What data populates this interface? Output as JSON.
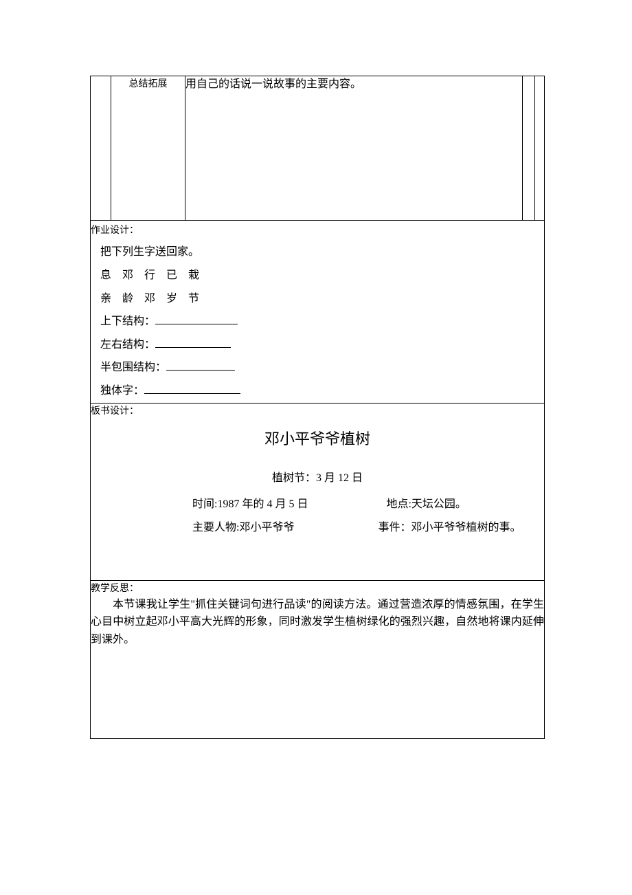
{
  "row1": {
    "label": "总结拓展",
    "content": "用自己的话说一说故事的主要内容。"
  },
  "homework": {
    "label": "作业设计：",
    "instruction": "把下列生字送回家。",
    "chars_line1": "息　邓　行　已　栽",
    "chars_line2": "亲　龄　邓　岁　节",
    "struct1_label": "上下结构：",
    "struct2_label": "左右结构：",
    "struct3_label": "半包围结构：",
    "struct4_label": "独体字："
  },
  "board": {
    "label": "板书设计：",
    "title": "邓小平爷爷植树",
    "subtitle": "植树节：3 月 12 日",
    "time_label": "时间:",
    "time_value": "1987 年的 4 月 5 日",
    "place_label": "地点:",
    "place_value": "天坛公园。",
    "person_label": "主要人物:",
    "person_value": "邓小平爷爷",
    "event_label": "事件：",
    "event_value": "邓小平爷爷植树的事。"
  },
  "reflection": {
    "label": "教学反思：",
    "body": "本节课我让学生\"抓住关键词句进行品读\"的阅读方法。通过营造浓厚的情感氛围，在学生心目中树立起邓小平高大光辉的形象，同时激发学生植树绿化的强烈兴趣，自然地将课内延伸到课外。"
  }
}
